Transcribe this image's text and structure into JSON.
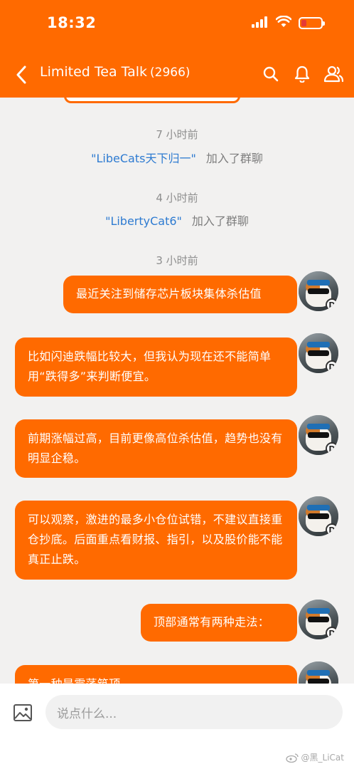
{
  "status_bar": {
    "time": "18:32"
  },
  "header": {
    "title": "Limited Tea Talk",
    "member_count": "(2966)"
  },
  "chat": {
    "events": [
      {
        "time": "7 小时前",
        "user": "\"LibeCats天下归一\"",
        "action": "加入了群聊"
      },
      {
        "time": "4 小时前",
        "user": "\"LibertyCat6\"",
        "action": "加入了群聊"
      }
    ],
    "messages_time": "3 小时前",
    "messages": [
      {
        "text": "最近关注到储存芯片板块集体杀估值"
      },
      {
        "text": "比如闪迪跌幅比较大，但我认为现在还不能简单用“跌得多”来判断便宜。"
      },
      {
        "text": "前期涨幅过高，目前更像高位杀估值，趋势也没有明显企稳。"
      },
      {
        "text": "可以观察，激进的最多小仓位试错，不建议直接重仓抄底。后面重点看财报、指引，以及股价能不能真正止跌。"
      },
      {
        "text": "顶部通常有两种走法："
      },
      {
        "text": "第一种是震荡筑顶"
      }
    ],
    "avatar_badge": "D"
  },
  "input": {
    "placeholder": "说点什么..."
  },
  "watermark": "@黑_LiCat",
  "colors": {
    "brand": "#ff6a00",
    "link": "#2e7bd1",
    "background": "#f2f1f0"
  }
}
